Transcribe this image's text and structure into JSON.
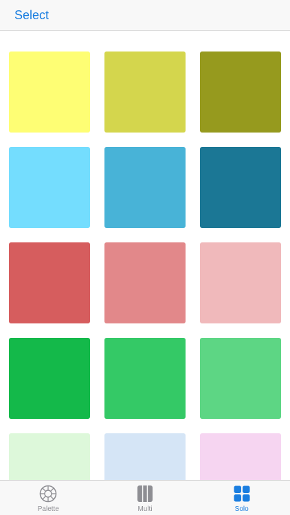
{
  "nav": {
    "select_label": "Select"
  },
  "colors": {
    "accent": "#1a7ee0",
    "tab_inactive": "#8e8e93"
  },
  "swatches": [
    "#fefe74",
    "#d4d64d",
    "#969a1e",
    "#74ddfe",
    "#48b3d7",
    "#1b7795",
    "#d65d5e",
    "#e2888a",
    "#f0b9bb",
    "#14b94a",
    "#34c966",
    "#5dd684",
    "#ddf8da",
    "#d5e5f6",
    "#f6d5f1"
  ],
  "tabs": [
    {
      "label": "Palette",
      "icon": "palette-wheel-icon",
      "active": false
    },
    {
      "label": "Multi",
      "icon": "multi-columns-icon",
      "active": false
    },
    {
      "label": "Solo",
      "icon": "solo-grid-icon",
      "active": true
    }
  ]
}
